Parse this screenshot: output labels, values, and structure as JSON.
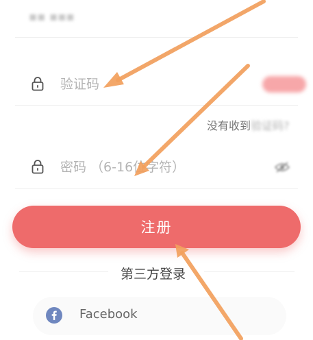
{
  "form": {
    "code_placeholder": "验证码",
    "no_code_tip": "没有收到",
    "no_code_tip_blurred": "验证码?",
    "password_placeholder": "密码 （6-16位字符）",
    "register_label": "注册"
  },
  "third_party": {
    "title": "第三方登录",
    "providers": [
      {
        "label": "Facebook",
        "icon": "facebook-icon"
      }
    ]
  },
  "colors": {
    "accent": "#ee6b6b",
    "facebook": "#6f87bf",
    "annotation_arrow": "#f2a05e"
  }
}
